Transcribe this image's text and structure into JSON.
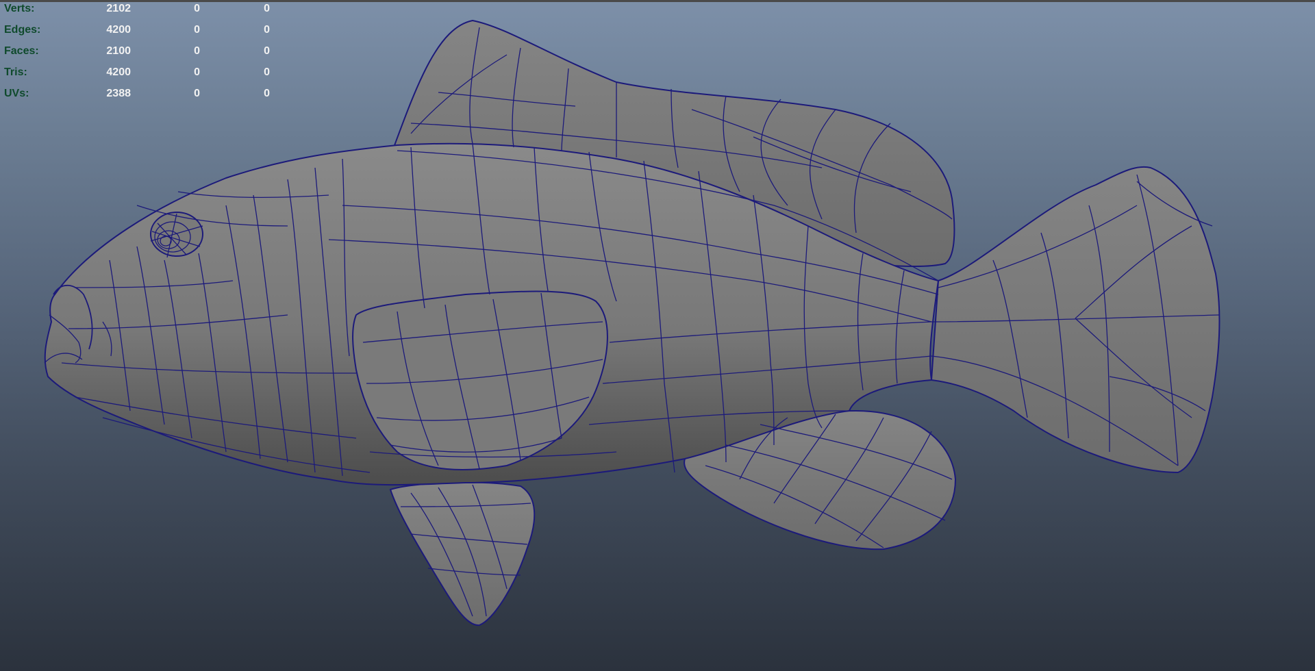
{
  "hud": {
    "rows": [
      {
        "label": "Verts:",
        "v1": "2102",
        "v2": "0",
        "v3": "0"
      },
      {
        "label": "Edges:",
        "v1": "4200",
        "v2": "0",
        "v3": "0"
      },
      {
        "label": "Faces:",
        "v1": "2100",
        "v2": "0",
        "v3": "0"
      },
      {
        "label": "Tris:",
        "v1": "4200",
        "v2": "0",
        "v3": "0"
      },
      {
        "label": "UVs:",
        "v1": "2388",
        "v2": "0",
        "v3": "0"
      }
    ]
  },
  "colors": {
    "wireframe": "#1c1a7a",
    "mesh_fill": "#7b7b7b",
    "hud_label": "#0f4a2c",
    "hud_value": "#f2f2f2"
  }
}
